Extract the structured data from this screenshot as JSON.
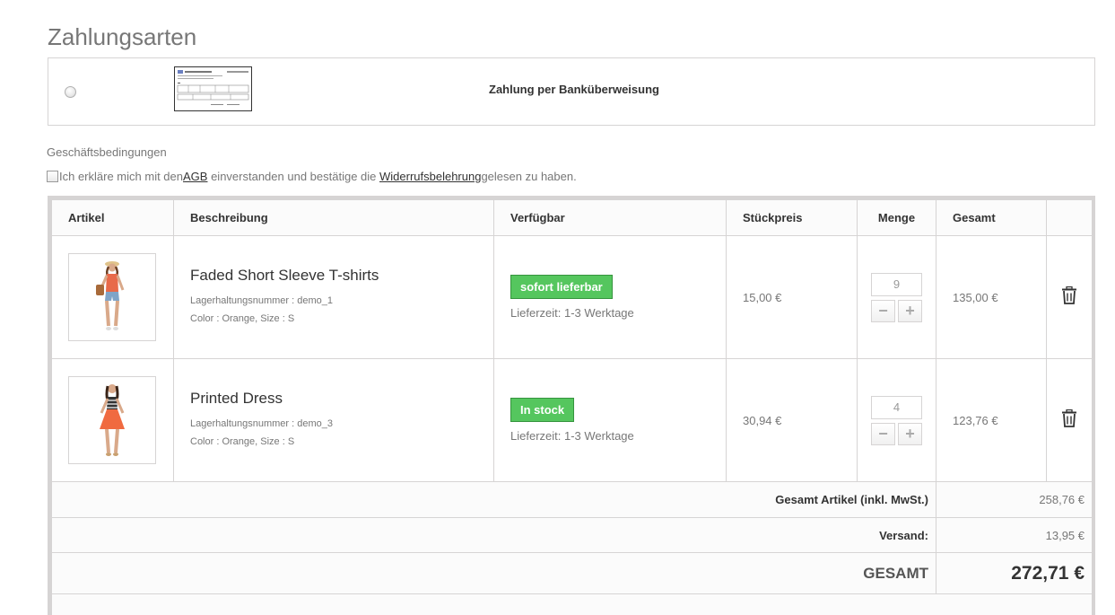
{
  "page": {
    "title": "Zahlungsarten"
  },
  "payment": {
    "label": "Zahlung per Banküberweisung"
  },
  "terms": {
    "heading": "Geschäftsbedingungen",
    "text_before": "Ich erkläre mich mit den ",
    "agb_link": "AGB",
    "text_middle": " einverstanden und bestätige die ",
    "widerruf_link": "Widerrufsbelehrung",
    "text_after": " gelesen zu haben."
  },
  "table": {
    "headers": [
      "Artikel",
      "Beschreibung",
      "Verfügbar",
      "Stückpreis",
      "Menge",
      "Gesamt"
    ],
    "items": [
      {
        "name": "Faded Short Sleeve T-shirts",
        "sku": "Lagerhaltungsnummer : demo_1",
        "attributes": "Color : Orange, Size : S",
        "availability": "sofort lieferbar",
        "delivery": "Lieferzeit: 1-3 Werktage",
        "unit_price": "15,00 €",
        "quantity": "9",
        "total": "135,00 €"
      },
      {
        "name": "Printed Dress",
        "sku": "Lagerhaltungsnummer : demo_3",
        "attributes": "Color : Orange, Size : S",
        "availability": "In stock",
        "delivery": "Lieferzeit: 1-3 Werktage",
        "unit_price": "30,94 €",
        "quantity": "4",
        "total": "123,76 €"
      }
    ],
    "summary": {
      "products_label": "Gesamt Artikel (inkl. MwSt.)",
      "products_value": "258,76 €",
      "shipping_label": "Versand:",
      "shipping_value": "13,95 €",
      "total_label": "GESAMT",
      "total_value": "272,71 €"
    }
  },
  "colors": {
    "in_stock_badge": "#55c65e",
    "border": "#d6d4d4"
  },
  "icons": {
    "delete": "trash-icon",
    "minus": "minus-icon",
    "plus": "plus-icon",
    "radio": "radio-unchecked",
    "checkbox": "checkbox-unchecked"
  }
}
